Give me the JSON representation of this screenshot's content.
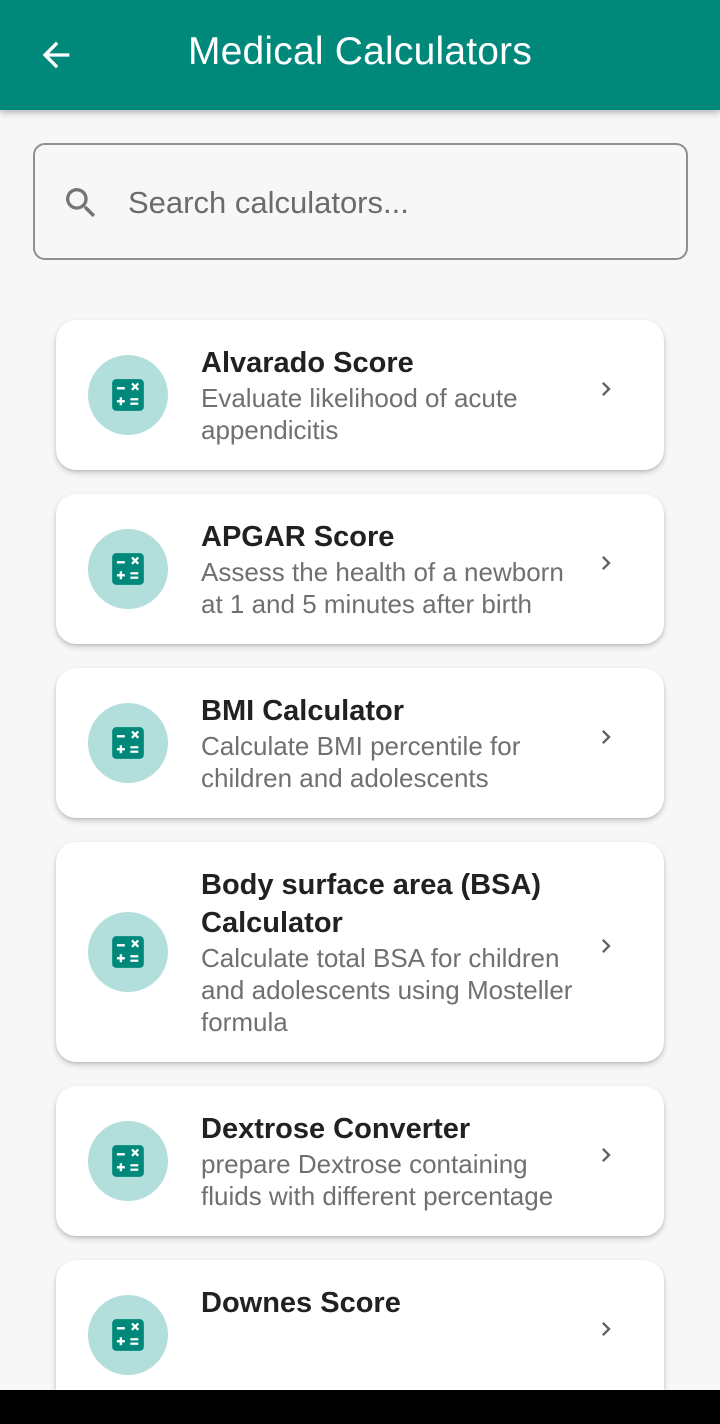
{
  "appbar": {
    "title": "Medical Calculators",
    "back_icon": "arrow-left-icon",
    "color": "#00897b"
  },
  "search": {
    "placeholder": "Search calculators...",
    "icon": "search-icon"
  },
  "calculators": [
    {
      "title": "Alvarado Score",
      "description": "Evaluate likelihood of acute appendicitis"
    },
    {
      "title": "APGAR Score",
      "description": "Assess the health of a newborn at 1 and 5 minutes after birth"
    },
    {
      "title": "BMI Calculator",
      "description": "Calculate BMI percentile for children and adolescents"
    },
    {
      "title": "Body surface area (BSA) Calculator",
      "description": "Calculate total BSA for children and adolescents using Mosteller formula"
    },
    {
      "title": "Dextrose Converter",
      "description": "prepare Dextrose containing fluids with different percentage"
    },
    {
      "title": "Downes Score",
      "description": ""
    }
  ],
  "item_icon": "calculator-icon",
  "item_icon_bg": "#b2dfdb",
  "item_icon_fg": "#00897b"
}
